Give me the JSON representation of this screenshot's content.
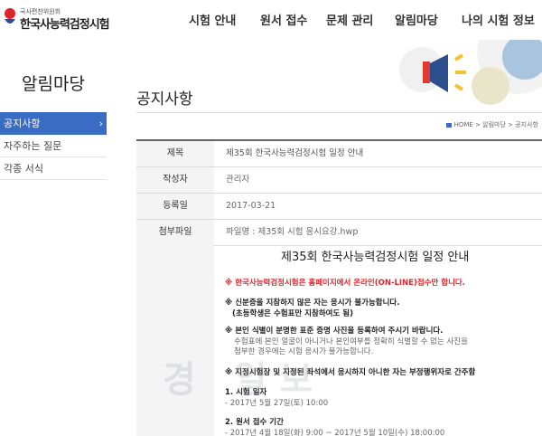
{
  "header": {
    "logo_sub": "국사편찬위원회",
    "logo_main": "한국사능력검정시험",
    "nav": [
      "시험 안내",
      "원서 접수",
      "문제 관리",
      "알림마당",
      "나의 시험 정보"
    ]
  },
  "sidebar": {
    "title": "알림마당",
    "items": [
      {
        "label": "공지사항",
        "arrow": "›"
      },
      {
        "label": "자주하는 질문"
      },
      {
        "label": "각종 서식"
      }
    ]
  },
  "page": {
    "title": "공지사항",
    "breadcrumb": "HOME > 알림마당 > 공지사항"
  },
  "info": {
    "rows": [
      {
        "label": "제목",
        "value": "제35회 한국사능력검정시험 일정 안내"
      },
      {
        "label": "작성자",
        "value": "관리자"
      },
      {
        "label": "등록일",
        "value": "2017-03-21"
      },
      {
        "label": "첨부파일",
        "value": "파일명 : 제35회 시험 응시요강.hwp"
      }
    ]
  },
  "content": {
    "title": "제35회 한국사능력검정시험 일정 안내",
    "notice1": "※ 한국사능력검정시험은 홈페이지에서 온라인(ON-LINE)접수만 합니다.",
    "notice2a": "※ 신분증을 지참하지 않은 자는 응시가 불가능합니다.",
    "notice2b": "(초등학생은 수험표만 지참하여도 됨)",
    "notice3a": "※ 본인 식별이 분명한 표준 증명 사진을 등록하여 주시기 바랍니다.",
    "notice3b": "수험표에 본인 얼굴이 아니거나 본인여부를 정확히 식별할 수 없는 사진을",
    "notice3c": "첨부한 경우에는 시험 응시가 불가능합니다.",
    "notice4": "※ 지정시험장 및 지정된 좌석에서 응시하지 아니한 자는 부정행위자로 간주함",
    "sec1_title": "1. 시험 일자",
    "sec1_value": "- 2017년 5월 27일(토) 10:00",
    "sec2_title": "2. 원서 접수 기간",
    "sec2_value": "- 2017년 4월 18일(화) 9:00 ~ 2017년 5월 10일(수) 18:00:00"
  },
  "watermark": "경 일보",
  "colors": {
    "accent": "#3b6cc3",
    "notice_red": "#e0242a"
  }
}
